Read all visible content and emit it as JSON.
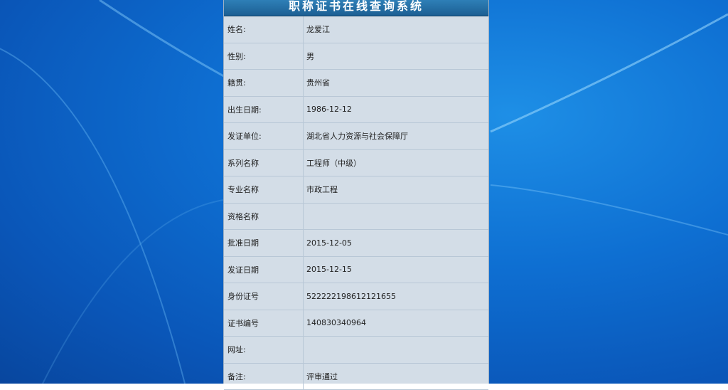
{
  "title": "职称证书在线查询系统",
  "rows": [
    {
      "label": "姓名:",
      "value": "龙爱江"
    },
    {
      "label": "性别:",
      "value": "男"
    },
    {
      "label": "籍贯:",
      "value": "贵州省"
    },
    {
      "label": "出生日期:",
      "value": "1986-12-12"
    },
    {
      "label": "发证单位:",
      "value": "湖北省人力资源与社会保障厅"
    },
    {
      "label": "系列名称",
      "value": "工程师（中级）"
    },
    {
      "label": "专业名称",
      "value": "市政工程"
    },
    {
      "label": "资格名称",
      "value": ""
    },
    {
      "label": "批准日期",
      "value": "2015-12-05"
    },
    {
      "label": "发证日期",
      "value": "2015-12-15"
    },
    {
      "label": "身份证号",
      "value": "522222198612121655"
    },
    {
      "label": "证书编号",
      "value": "140830340964"
    },
    {
      "label": "网址:",
      "value": ""
    },
    {
      "label": "备注:",
      "value": "评审通过"
    }
  ]
}
